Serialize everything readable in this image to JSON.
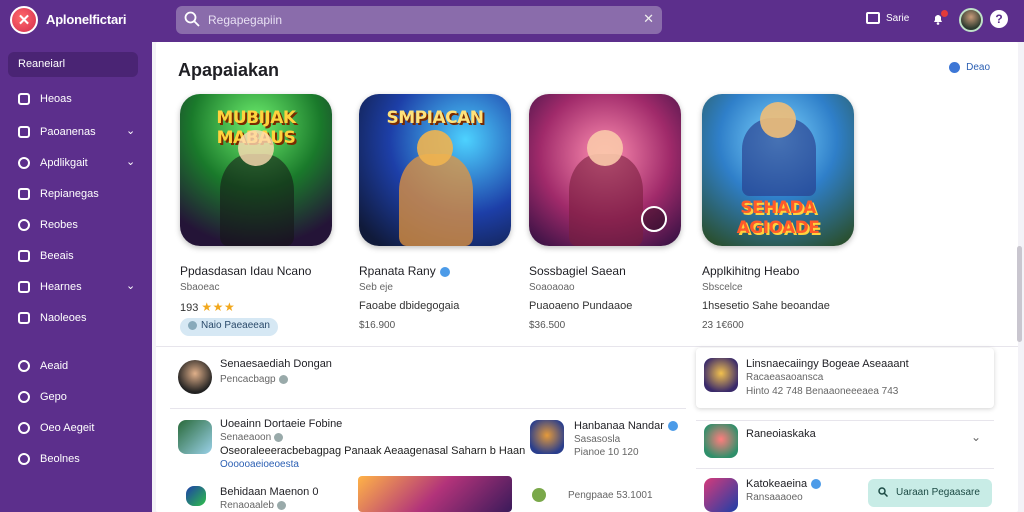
{
  "app": {
    "title": "Aplonelfictari"
  },
  "search": {
    "placeholder": "Regapegapiin"
  },
  "topbar": {
    "score_label": "Sarie"
  },
  "sidebar": {
    "search_label": "Reaneiarl",
    "items": [
      {
        "label": "Heoas",
        "icon": "home-icon",
        "chevron": false
      },
      {
        "label": "Paoanenas",
        "icon": "grid-icon",
        "chevron": true
      },
      {
        "label": "Apdlikgait",
        "icon": "puzzle-icon",
        "chevron": true
      },
      {
        "label": "Repianegas",
        "icon": "calendar-icon",
        "chevron": false
      },
      {
        "label": "Reobes",
        "icon": "shield-icon",
        "chevron": false
      },
      {
        "label": "Beeais",
        "icon": "list-icon",
        "chevron": false
      },
      {
        "label": "Hearnes",
        "icon": "flag-icon",
        "chevron": true
      },
      {
        "label": "Naoleoes",
        "icon": "news-icon",
        "chevron": false
      },
      {
        "label": "Aeaid",
        "icon": "info-icon",
        "chevron": false
      },
      {
        "label": "Gepo",
        "icon": "compass-icon",
        "chevron": false
      },
      {
        "label": "Oeo Aegeit",
        "icon": "target-icon",
        "chevron": false
      },
      {
        "label": "Beolnes",
        "icon": "globe-icon",
        "chevron": false
      }
    ]
  },
  "main": {
    "section_title": "Apapaiakan",
    "see_more": "Deao",
    "games": [
      {
        "art_text": "MUBIJAK MABAUS",
        "name": "Ppdasdasan Idau Ncano",
        "dev": "Sbaoeac",
        "rating_text": "193",
        "pill": "Naio   Paeaeean",
        "accent": "#2fbf4a"
      },
      {
        "art_text": "SMPIACAN",
        "name": "Rpanata Rany",
        "dev": "Seb eje",
        "line3": "Faoabe dbidegogaia",
        "price": "$16.900",
        "verified": true,
        "accent": "#1e5fd6"
      },
      {
        "art_text": "",
        "name": "Sossbagiel Saean",
        "dev": "Soaoaoao",
        "line3": "Puaoaeno Pundaaoe",
        "price": "$36.500",
        "accent": "#d63a7a"
      },
      {
        "art_text": "SEHADA AGIOADE",
        "name": "Applkihitng Heabo",
        "dev": "Sbscelce",
        "line3": "1hsesetio   Sahe beoandae",
        "price": "23 1€600",
        "accent": "#e07a1f"
      }
    ]
  },
  "feed": {
    "rows": [
      {
        "title": "Senaesaediah Dongan",
        "sub": "Pencacbagp"
      },
      {
        "title": "Uoeainn Dortaeie Fobine",
        "sub": "Senaeaoon",
        "text": "Oseoraleeeracbebagpag Panaak Aeaagenasal Saharn b Haan",
        "link": "Oooooaeioeoesta"
      },
      {
        "title": "Behidaan Maenon 0",
        "sub": "Renaoaaleb"
      }
    ],
    "mid_rows": [
      {
        "title": "Hanbanaa Nandar",
        "sub": "Sasasosla",
        "meta": "Pianoe   10   120"
      },
      {
        "title": "",
        "sub": "",
        "meta": "Pengpaae   53.1001"
      }
    ]
  },
  "right_panel": {
    "card": {
      "title": "Linsnaecaiingy Bogeae Aseaaant",
      "sub": "Racaeasaoansca",
      "meta": "Hinto   42   748   Benaaoneeeaea   743"
    },
    "rows": [
      {
        "title": "Raneoiaskaka"
      },
      {
        "title": "Katokeaeina",
        "sub": "Ransaaaoeo"
      }
    ],
    "action_button": "Uaraan Pegaasare"
  }
}
